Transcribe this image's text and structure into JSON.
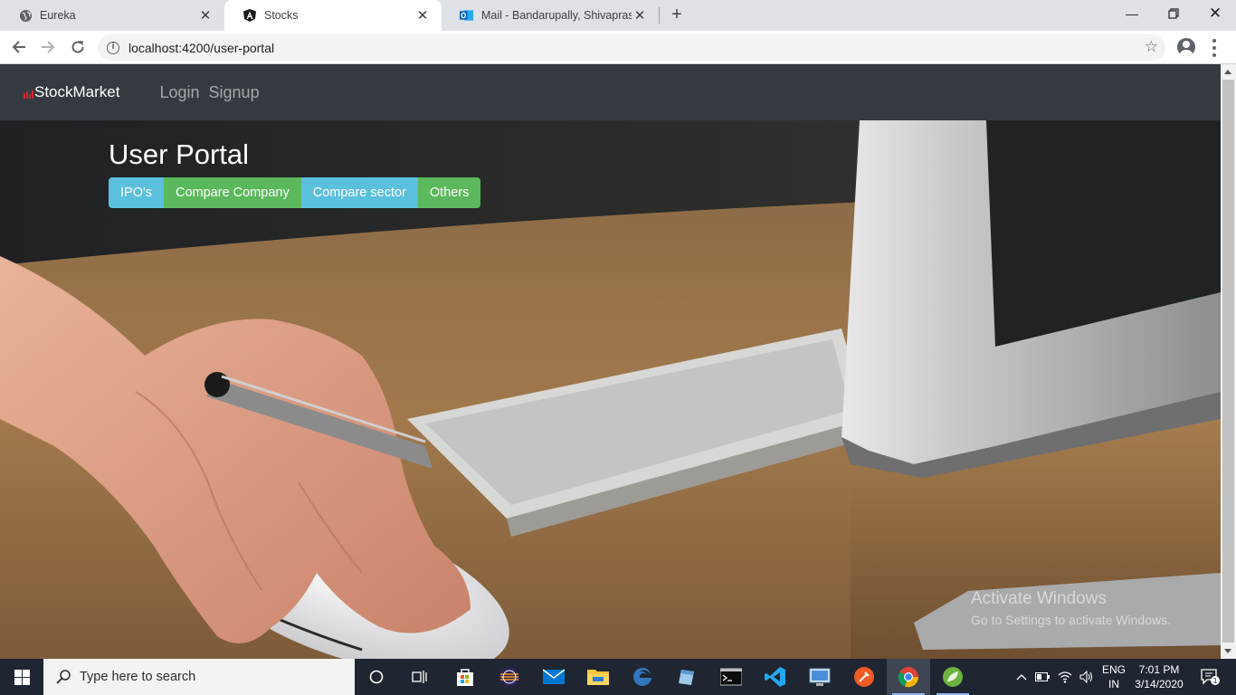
{
  "browser": {
    "tabs": [
      {
        "title": "Eureka",
        "favicon": "globe-icon",
        "active": false
      },
      {
        "title": "Stocks",
        "favicon": "angular-icon",
        "active": true
      },
      {
        "title": "Mail - Bandarupally, Shivaprasad",
        "favicon": "outlook-icon",
        "active": false
      }
    ],
    "new_tab_label": "+",
    "url": "localhost:4200/user-portal"
  },
  "app": {
    "brand": "StockMarket",
    "nav_links": [
      "Login",
      "Signup"
    ],
    "page_title": "User Portal",
    "buttons": [
      {
        "label": "IPO's",
        "style": "info"
      },
      {
        "label": "Compare Company",
        "style": "success"
      },
      {
        "label": "Compare sector",
        "style": "info"
      },
      {
        "label": "Others",
        "style": "success"
      }
    ],
    "colors": {
      "navbar": "#343a40",
      "info": "#5bc0de",
      "success": "#5cb85c"
    }
  },
  "watermark": {
    "line1": "Activate Windows",
    "line2": "Go to Settings to activate Windows."
  },
  "taskbar": {
    "search_placeholder": "Type here to search",
    "apps": [
      "cortana-icon",
      "task-view-icon",
      "store-icon",
      "eclipse-icon",
      "mail-icon",
      "file-explorer-icon",
      "edge-icon",
      "notes-icon",
      "terminal-icon",
      "vscode-icon",
      "remote-desktop-icon",
      "postman-icon",
      "chrome-icon",
      "spring-icon"
    ],
    "language_line1": "ENG",
    "language_line2": "IN",
    "time": "7:01 PM",
    "date": "3/14/2020",
    "notification_count": "1"
  }
}
